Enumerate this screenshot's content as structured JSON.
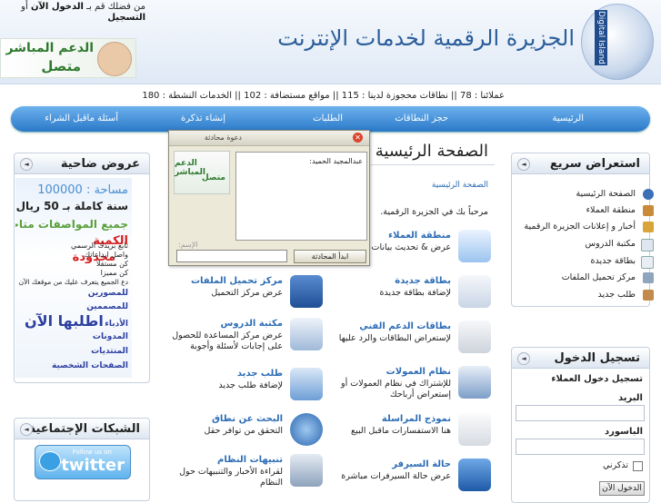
{
  "header": {
    "site_title": "الجزيرة الرقمية لخدمات الإنترنت",
    "logo_text": "Digital Island",
    "login_prompt_1": "من فضلك قم بـ",
    "login_prompt_link1": "الدخول الآن",
    "login_prompt_or": "أو",
    "login_prompt_link2": "التسجيل",
    "support_line1": "الدعم المباشر",
    "support_line2": "متصل"
  },
  "stats": {
    "text": "عملائنا : 78 || نطاقات محجوزة لدينا : 115 || مواقع مستضافة : 102 || الخدمات النشطة : 180"
  },
  "nav": [
    "الرئيسية",
    "حجز النطاقات",
    "الطلبات",
    "إنشاء تذكرة",
    "أسئلة ماقبل الشراء"
  ],
  "quick": {
    "title": "استعراض سريع",
    "items": [
      "الصفحة الرئيسية",
      "منطقة العملاء",
      "أخبار و إعلانات الجزيرة الرقمية",
      "مكتبة الدروس",
      "بطاقة جديدة",
      "مركز تحميل الملفات",
      "طلب جديد"
    ]
  },
  "offers": {
    "title": "عروض ضاحية",
    "ad_area": "مساحة : 100000",
    "ad_price": "سنة كاملة بـ 50 ريال",
    "ad_specs": "جميع المواصفات متاحة",
    "ad_qty1": "الكمية",
    "ad_qty2": "محدودة",
    "ad_t1": "تابع بريدك الرسمي",
    "ad_t2": "واصل ابداعاتك",
    "ad_t3": "كن مستقلا",
    "ad_t4": "كن مميزا",
    "ad_t5": "دع الجميع يتعرف عليك من موقعك الآن",
    "ad_l1": "للمصورين",
    "ad_l2": "للمصممين",
    "ad_l3": "الأدباء",
    "ad_l4": "المدونات",
    "ad_l5": "المنتديات",
    "ad_l6": "الصفحات الشخصية",
    "ad_cta": "اطلبها الآن"
  },
  "social": {
    "title": "الشبكات الإجتماعية",
    "follow": "Follow us on",
    "twitter": "twitter"
  },
  "main": {
    "title": "الصفحة الرئيسية",
    "breadcrumb": "الصفحة الرئيسية",
    "welcome": "مرحباً بك في الجزيرة الرقمية."
  },
  "services": [
    {
      "title": "منطقة العملاء",
      "desc": "عرض & تحديث بيانات"
    },
    {
      "title": "مركز تحميل الملفات",
      "desc": "عرض مركز التحميل"
    },
    {
      "title": "بطاقة جديدة",
      "desc": "لإضافة بطاقة جديدة"
    },
    {
      "title": "مكتبة الدروس",
      "desc": "عرض مركز المساعدة للحصول على إجابات لأسئلة وأجوبة"
    },
    {
      "title": "بطاقات الدعم الفني",
      "desc": "لإستعراض البطاقات والرد عليها"
    },
    {
      "title": "طلب جديد",
      "desc": "لإضافة طلب جديد"
    },
    {
      "title": "نظام العمولات",
      "desc": "للإشتراك في نظام العمولات أو إستعراض أرباحك"
    },
    {
      "title": "البحث عن نطاق",
      "desc": "التحقق من توافر حقل"
    },
    {
      "title": "نموذج المراسلة",
      "desc": "هنا الاستفسارات ماقبل البيع"
    },
    {
      "title": "تنبيهات النظام",
      "desc": "لقراءة الأخبار والتنبيهات حول النظام"
    },
    {
      "title": "حالة السيرفر",
      "desc": "عرض حالة السيرفرات مباشرة"
    }
  ],
  "chat": {
    "title": "دعوة محادثة",
    "message": "عبدالمجيد الحميد:",
    "name_label": "الإسم:",
    "start_button": "ابدأ المحادثة",
    "logo_line1": "الدعم المباشر",
    "logo_line2": "متصل"
  },
  "login": {
    "title": "تسجيل الدخول",
    "subtitle": "تسجيل دخول العملاء",
    "email_label": "البريد",
    "password_label": "الباسورد",
    "remember_label": "تذكرني",
    "login_button": "الدخول الآن"
  },
  "colors": {
    "nav": "#2a78c8",
    "link": "#2d6db5",
    "title": "#2a5d9a"
  }
}
